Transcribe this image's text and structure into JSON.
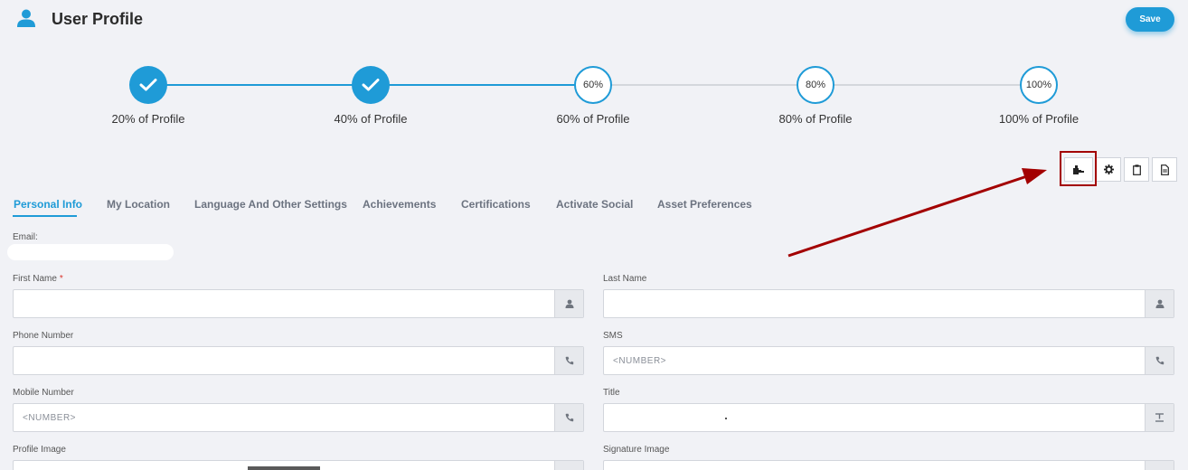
{
  "header": {
    "title": "User Profile",
    "save_label": "Save",
    "icon": "user-icon"
  },
  "progress": {
    "steps": [
      {
        "label": "20% of Profile",
        "badge": "",
        "completed": true
      },
      {
        "label": "40% of Profile",
        "badge": "",
        "completed": true
      },
      {
        "label": "60% of Profile",
        "badge": "60%",
        "completed": false
      },
      {
        "label": "80% of Profile",
        "badge": "80%",
        "completed": false
      },
      {
        "label": "100% of Profile",
        "badge": "100%",
        "completed": false
      }
    ]
  },
  "toolbar": {
    "buttons": [
      {
        "icon": "puzzle-icon"
      },
      {
        "icon": "gear-icon"
      },
      {
        "icon": "clipboard-icon"
      },
      {
        "icon": "document-icon"
      }
    ]
  },
  "tabs": [
    {
      "label": "Personal Info",
      "active": true
    },
    {
      "label": "My Location",
      "active": false
    },
    {
      "label": "Language And Other Settings",
      "active": false
    },
    {
      "label": "Achievements",
      "active": false
    },
    {
      "label": "Certifications",
      "active": false
    },
    {
      "label": "Activate Social",
      "active": false
    },
    {
      "label": "Asset Preferences",
      "active": false
    }
  ],
  "email": {
    "label": "Email:"
  },
  "fields": {
    "first_name": {
      "label": "First Name",
      "required_mark": "*",
      "value": "",
      "placeholder": "",
      "icon": "person-icon"
    },
    "last_name": {
      "label": "Last Name",
      "value": "",
      "placeholder": "",
      "icon": "person-icon"
    },
    "phone_number": {
      "label": "Phone Number",
      "value": "",
      "placeholder": "",
      "icon": "phone-icon"
    },
    "sms": {
      "label": "SMS",
      "value": "",
      "placeholder": "<NUMBER>",
      "icon": "phone-icon"
    },
    "mobile_number": {
      "label": "Mobile Number",
      "value": "",
      "placeholder": "<NUMBER>",
      "icon": "phone-icon"
    },
    "title": {
      "label": "Title",
      "value": "",
      "placeholder": "",
      "icon": "text-format-icon"
    },
    "profile_image": {
      "label": "Profile Image"
    },
    "signature_image": {
      "label": "Signature Image"
    }
  },
  "colors": {
    "accent": "#1f9bd7",
    "background": "#f1f2f6",
    "annotation": "#a30000"
  }
}
